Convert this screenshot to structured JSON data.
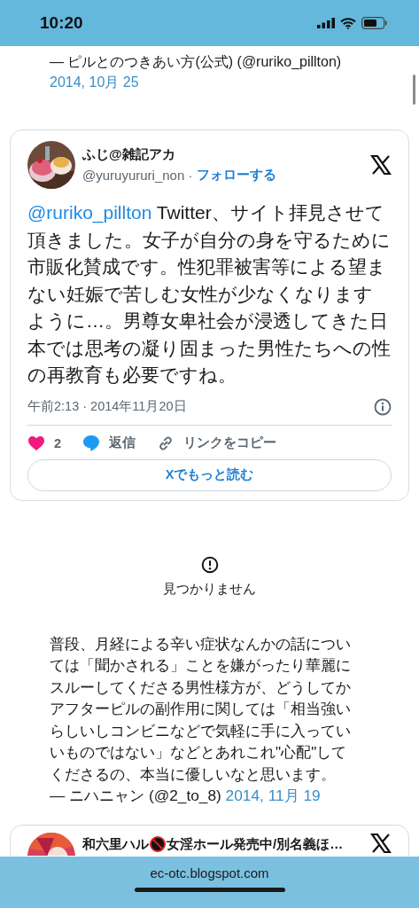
{
  "status_bar": {
    "time": "10:20"
  },
  "quote_top": {
    "attribution": "— ピルとのつきあい方(公式) (@ruriko_pillton)",
    "date": "2014, 10月 25"
  },
  "tweet": {
    "name": "ふじ@雑記アカ",
    "handle": "@yuruyururi_non",
    "separator": "·",
    "follow": "フォローする",
    "mention": "@ruriko_pillton",
    "text": " Twitter、サイト拝見させて頂きました。女子が自分の身を守るために市販化賛成です。性犯罪被害等による望まない妊娠で苦しむ女性が少なくなりますように…。男尊女卑社会が浸透してきた日本では思考の凝り固まった男性たちへの性の再教育も必要ですね。",
    "timestamp": "午前2:13 · 2014年11月20日",
    "likes": "2",
    "reply": "返信",
    "copy_link": "リンクをコピー",
    "read_more": "Xでもっと読む"
  },
  "not_found": {
    "message": "見つかりません"
  },
  "quote": {
    "text": "普段、月経による辛い症状なんかの話については「聞かされる」ことを嫌がったり華麗にスルーしてくださる男性様方が、どうしてかアフターピルの副作用に関しては「相当強いらしいしコンビニなどで気軽に手に入っていいものではない」などとあれこれ\"心配\"してくださるの、本当に優しいなと思います。",
    "attribution": "— ニハニャン (@2_to_8)",
    "date": "2014, 11月 19"
  },
  "tweet_2": {
    "name_before": "和六里ハル",
    "name_after": "女淫ホール発売中/別名義ほ…"
  },
  "browser_bar": {
    "url": "ec-otc.blogspot.com"
  }
}
